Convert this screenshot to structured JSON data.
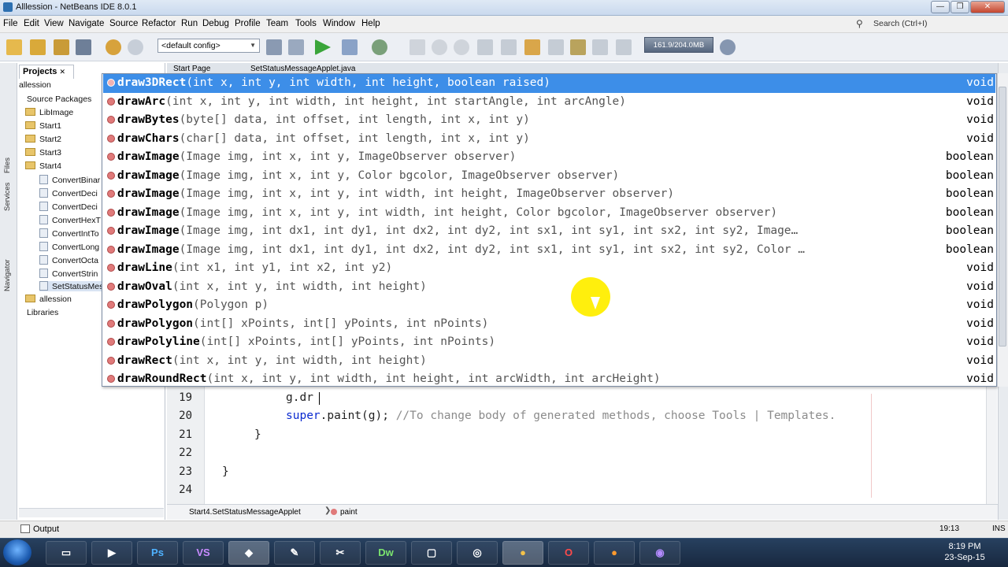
{
  "window": {
    "title": "Alllession - NetBeans IDE 8.0.1",
    "min": "—",
    "max": "❐",
    "close": "✕"
  },
  "menu": [
    "File",
    "Edit",
    "View",
    "Navigate",
    "Source",
    "Refactor",
    "Run",
    "Debug",
    "Profile",
    "Team",
    "Tools",
    "Window",
    "Help"
  ],
  "search": {
    "placeholder": "Search (Ctrl+I)"
  },
  "toolbar": {
    "config": "<default config>",
    "memory": "161.9/204.0MB"
  },
  "side_tabs": {
    "files": "Files",
    "services": "Services",
    "navigator": "Navigator"
  },
  "projects": {
    "tab": "Projects",
    "tree": [
      "allession",
      "Source Packages",
      "LibImage",
      "Start1",
      "Start2",
      "Start3",
      "Start4",
      "ConvertBinar",
      "ConvertDeci",
      "ConvertDeci",
      "ConvertHexT",
      "ConvertIntTo",
      "ConvertLong",
      "ConvertOcta",
      "ConvertStrin",
      "SetStatusMes",
      "allession",
      "Libraries"
    ]
  },
  "editor": {
    "tabs": [
      "Start Page",
      "SetStatusMessageApplet.java"
    ],
    "lines": [
      {
        "num": "19",
        "code": "g.dr"
      },
      {
        "num": "20",
        "code": "super.paint(g); //To change body of generated methods, choose Tools | Templates."
      },
      {
        "num": "21",
        "code": "}"
      },
      {
        "num": "22",
        "code": ""
      },
      {
        "num": "23",
        "code": "}"
      },
      {
        "num": "24",
        "code": ""
      }
    ],
    "breadcrumb": [
      "Start4.SetStatusMessageApplet",
      "paint"
    ]
  },
  "completion": [
    {
      "method": "draw3DRect",
      "params": "(int x, int y, int width, int height, boolean raised)",
      "returns": "void"
    },
    {
      "method": "drawArc",
      "params": "(int x, int y, int width, int height, int startAngle, int arcAngle)",
      "returns": "void"
    },
    {
      "method": "drawBytes",
      "params": "(byte[] data, int offset, int length, int x, int y)",
      "returns": "void"
    },
    {
      "method": "drawChars",
      "params": "(char[] data, int offset, int length, int x, int y)",
      "returns": "void"
    },
    {
      "method": "drawImage",
      "params": "(Image img, int x, int y, ImageObserver observer)",
      "returns": "boolean"
    },
    {
      "method": "drawImage",
      "params": "(Image img, int x, int y, Color bgcolor, ImageObserver observer)",
      "returns": "boolean"
    },
    {
      "method": "drawImage",
      "params": "(Image img, int x, int y, int width, int height, ImageObserver observer)",
      "returns": "boolean"
    },
    {
      "method": "drawImage",
      "params": "(Image img, int x, int y, int width, int height, Color bgcolor, ImageObserver observer)",
      "returns": "boolean"
    },
    {
      "method": "drawImage",
      "params": "(Image img, int dx1, int dy1, int dx2, int dy2, int sx1, int sy1, int sx2, int sy2, Image…",
      "returns": "boolean"
    },
    {
      "method": "drawImage",
      "params": "(Image img, int dx1, int dy1, int dx2, int dy2, int sx1, int sy1, int sx2, int sy2, Color …",
      "returns": "boolean"
    },
    {
      "method": "drawLine",
      "params": "(int x1, int y1, int x2, int y2)",
      "returns": "void"
    },
    {
      "method": "drawOval",
      "params": "(int x, int y, int width, int height)",
      "returns": "void"
    },
    {
      "method": "drawPolygon",
      "params": "(Polygon p)",
      "returns": "void"
    },
    {
      "method": "drawPolygon",
      "params": "(int[] xPoints, int[] yPoints, int nPoints)",
      "returns": "void"
    },
    {
      "method": "drawPolyline",
      "params": "(int[] xPoints, int[] yPoints, int nPoints)",
      "returns": "void"
    },
    {
      "method": "drawRect",
      "params": "(int x, int y, int width, int height)",
      "returns": "void"
    },
    {
      "method": "drawRoundRect",
      "params": "(int x, int y, int width, int height, int arcWidth, int arcHeight)",
      "returns": "void"
    }
  ],
  "status": {
    "output": "Output",
    "position": "19:13",
    "mode": "INS"
  },
  "taskbar": {
    "apps": [
      "Ps",
      "VS",
      "Dw"
    ],
    "time": "8:19 PM",
    "date": "23-Sep-15"
  },
  "colors": {
    "selection": "#3d8ee8",
    "cursor_highlight": "#ffee00"
  }
}
